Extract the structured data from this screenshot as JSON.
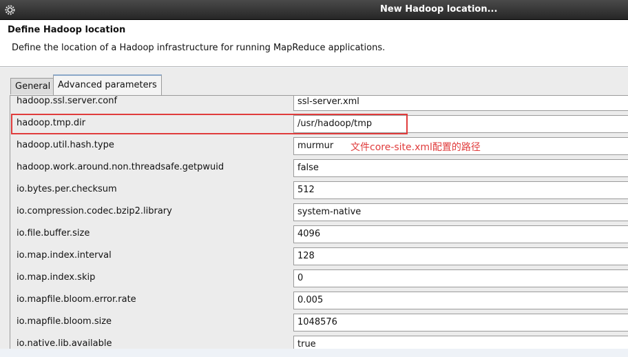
{
  "window": {
    "title": "New Hadoop location...",
    "icon": "gear-icon"
  },
  "header": {
    "title": "Define Hadoop location",
    "description": "Define the location of a Hadoop infrastructure for running MapReduce applications."
  },
  "tabs": [
    {
      "label": "General",
      "selected": false
    },
    {
      "label": "Advanced parameters",
      "selected": true
    }
  ],
  "parameters": [
    {
      "key": "hadoop.ssl.server.conf",
      "value": "ssl-server.xml"
    },
    {
      "key": "hadoop.tmp.dir",
      "value": "/usr/hadoop/tmp"
    },
    {
      "key": "hadoop.util.hash.type",
      "value": "murmur"
    },
    {
      "key": "hadoop.work.around.non.threadsafe.getpwuid",
      "value": "false"
    },
    {
      "key": "io.bytes.per.checksum",
      "value": "512"
    },
    {
      "key": "io.compression.codec.bzip2.library",
      "value": "system-native"
    },
    {
      "key": "io.file.buffer.size",
      "value": "4096"
    },
    {
      "key": "io.map.index.interval",
      "value": "128"
    },
    {
      "key": "io.map.index.skip",
      "value": "0"
    },
    {
      "key": "io.mapfile.bloom.error.rate",
      "value": "0.005"
    },
    {
      "key": "io.mapfile.bloom.size",
      "value": "1048576"
    },
    {
      "key": "io.native.lib.available",
      "value": "true"
    }
  ],
  "annotation": {
    "text": "文件core-site.xml配置的路径",
    "color": "#e03b3b"
  }
}
